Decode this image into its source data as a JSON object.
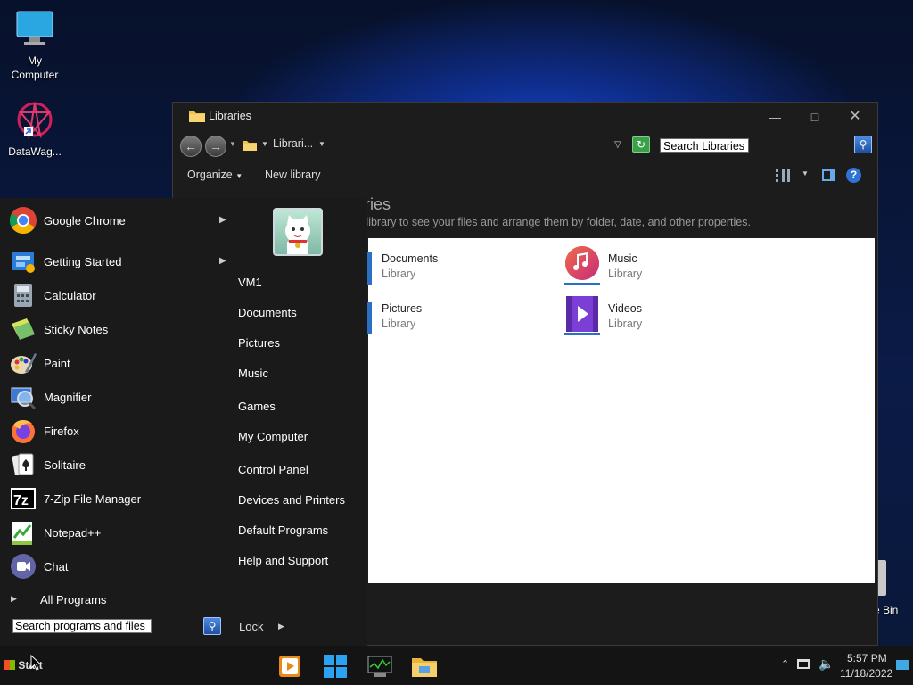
{
  "desktop": {
    "icons": [
      {
        "label": "My\nComputer"
      },
      {
        "label": "DataWag..."
      },
      {
        "label": "e Bin"
      }
    ]
  },
  "explorer": {
    "title": "Libraries",
    "address": "Librari...",
    "search_placeholder": "Search Libraries",
    "toolbar": {
      "organize": "Organize",
      "new_library": "New library"
    },
    "header_partial": "ries",
    "description_partial": "n library to see your files and arrange them by folder, date, and other properties.",
    "libraries": [
      {
        "name": "Documents",
        "type": "Library"
      },
      {
        "name": "Music",
        "type": "Library"
      },
      {
        "name": "Pictures",
        "type": "Library"
      },
      {
        "name": "Videos",
        "type": "Library"
      }
    ]
  },
  "start_menu": {
    "programs": [
      {
        "label": "Google Chrome",
        "has_submenu": true
      },
      {
        "label": "Getting Started",
        "has_submenu": true
      },
      {
        "label": "Calculator"
      },
      {
        "label": "Sticky Notes"
      },
      {
        "label": "Paint"
      },
      {
        "label": "Magnifier"
      },
      {
        "label": "Firefox"
      },
      {
        "label": "Solitaire"
      },
      {
        "label": "7-Zip File Manager"
      },
      {
        "label": "Notepad++"
      },
      {
        "label": "Chat"
      }
    ],
    "all_programs": "All Programs",
    "search_placeholder": "Search programs and files",
    "right": [
      {
        "label": "VM1"
      },
      {
        "label": "Documents"
      },
      {
        "label": "Pictures"
      },
      {
        "label": "Music"
      },
      {
        "label": "Games"
      },
      {
        "label": "My Computer"
      },
      {
        "label": "Control Panel"
      },
      {
        "label": "Devices and Printers"
      },
      {
        "label": "Default Programs"
      },
      {
        "label": "Help and Support"
      }
    ],
    "lock": "Lock"
  },
  "taskbar": {
    "start_label": "Start",
    "time": "5:57 PM",
    "date": "11/18/2022"
  }
}
